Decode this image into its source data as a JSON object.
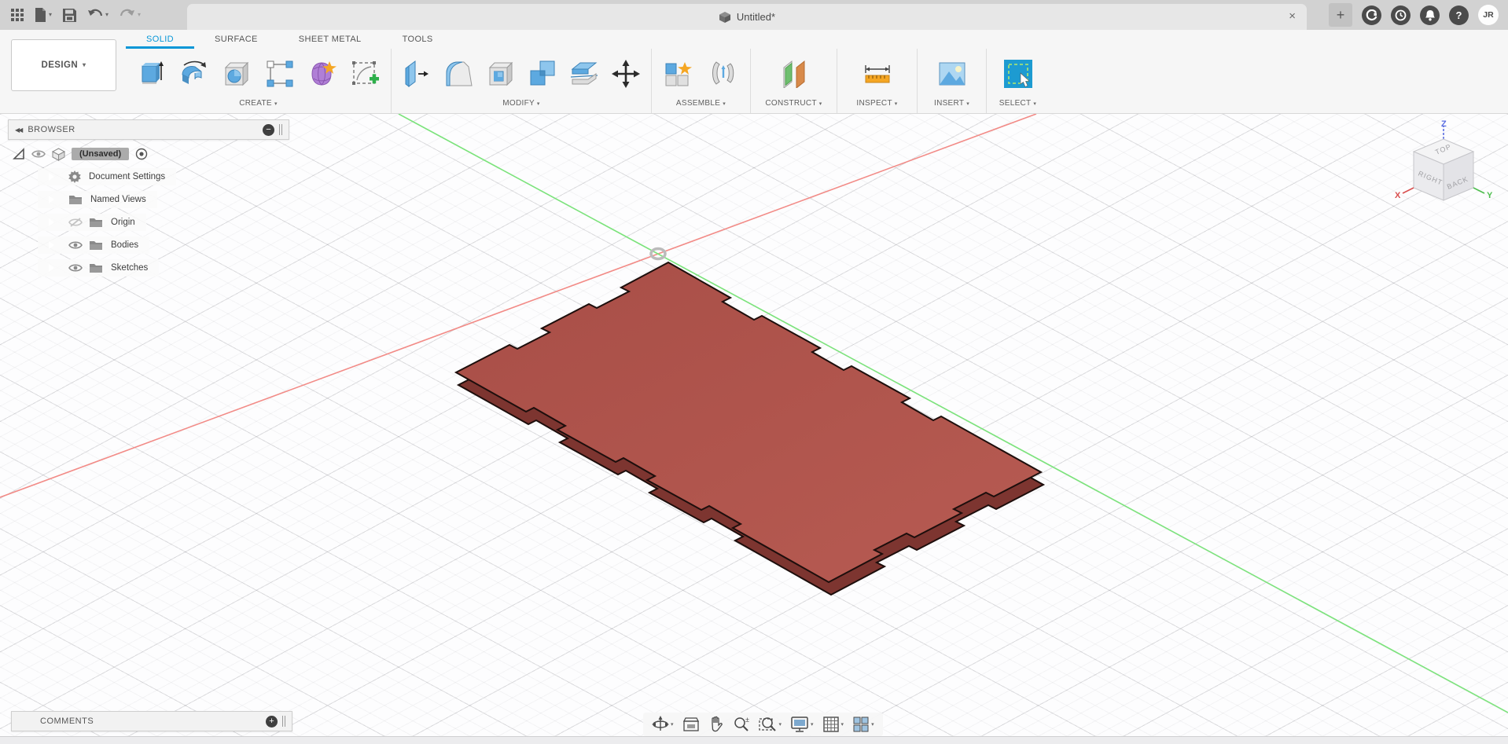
{
  "titlebar": {
    "title": "Untitled*",
    "avatar": "JR"
  },
  "workspace": {
    "label": "DESIGN"
  },
  "tabs": {
    "items": [
      "SOLID",
      "SURFACE",
      "SHEET METAL",
      "TOOLS"
    ],
    "active": "SOLID"
  },
  "groups": [
    {
      "label": "CREATE"
    },
    {
      "label": "MODIFY"
    },
    {
      "label": "ASSEMBLE"
    },
    {
      "label": "CONSTRUCT"
    },
    {
      "label": "INSPECT"
    },
    {
      "label": "INSERT"
    },
    {
      "label": "SELECT"
    }
  ],
  "browser": {
    "header": "BROWSER",
    "root": "(Unsaved)",
    "items": [
      {
        "label": "Document Settings",
        "icon": "gear-icon",
        "visibility": "none"
      },
      {
        "label": "Named Views",
        "icon": "folder-icon",
        "visibility": "none"
      },
      {
        "label": "Origin",
        "icon": "folder-icon",
        "visibility": "hidden"
      },
      {
        "label": "Bodies",
        "icon": "folder-icon",
        "visibility": "visible"
      },
      {
        "label": "Sketches",
        "icon": "folder-icon",
        "visibility": "visible"
      }
    ]
  },
  "comments": {
    "header": "COMMENTS"
  },
  "viewcube": {
    "top": "TOP",
    "left": "RIGHT",
    "right": "BACK",
    "x": "X",
    "y": "Y",
    "z": "Z"
  },
  "ui": {
    "caret": "▾",
    "close": "×",
    "plus": "+",
    "help": "?",
    "collapse": "◀◀",
    "minus": "−"
  },
  "navbar": {
    "tools": [
      "orbit",
      "look-at",
      "pan",
      "zoom",
      "fit",
      "display-settings",
      "grid-and-snaps",
      "viewports"
    ]
  },
  "colors": {
    "accent": "#0696d7",
    "plate_top": "#b0544c",
    "plate_side": "#7d3530",
    "axis_x": "#f28b87",
    "axis_y": "#7be37b",
    "viewcube_x": "#d94f4f",
    "viewcube_y": "#4fbf4f",
    "viewcube_z": "#5b6ee1"
  }
}
